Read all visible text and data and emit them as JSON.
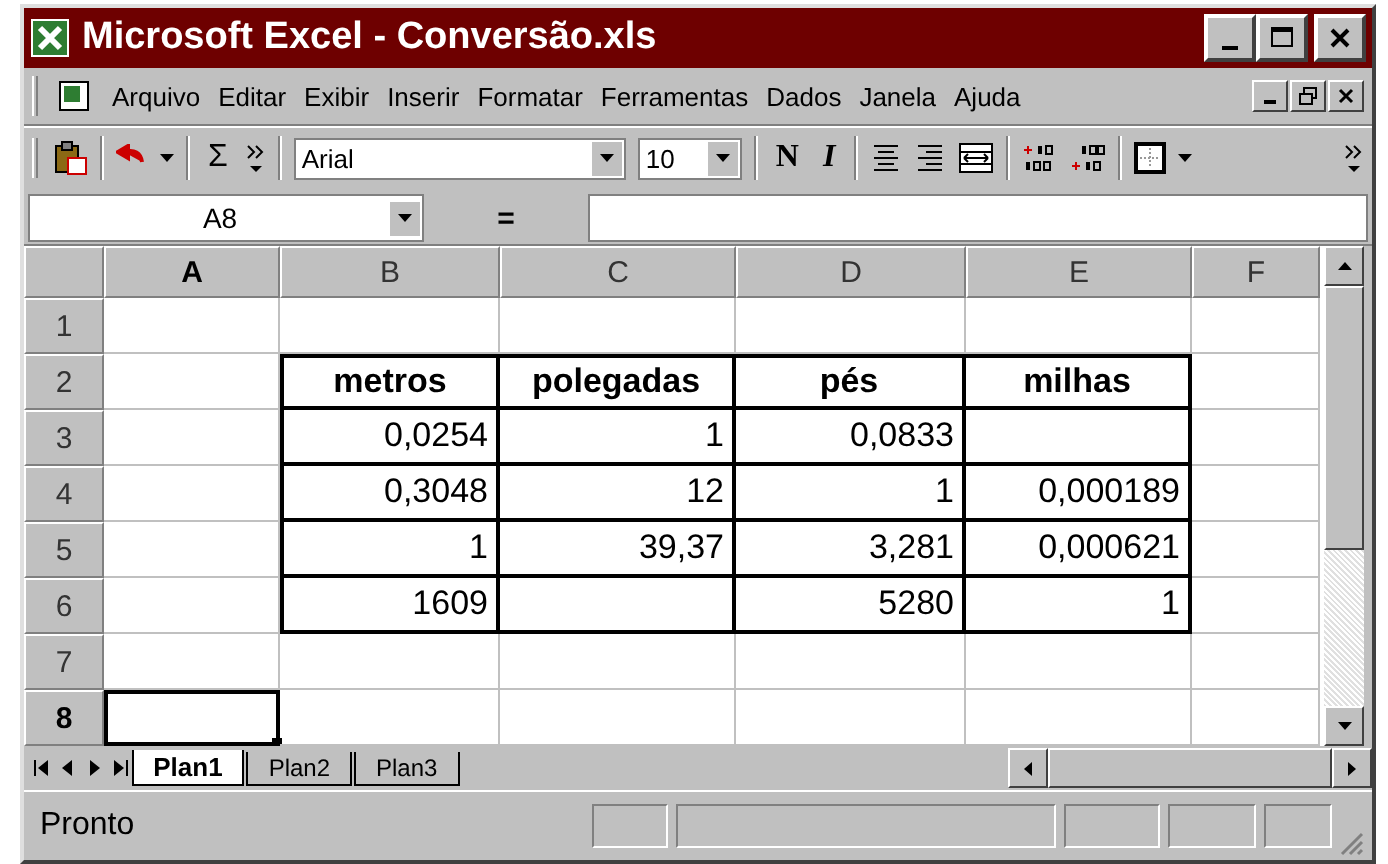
{
  "window": {
    "title": "Microsoft Excel - Conversão.xls"
  },
  "menu": [
    "Arquivo",
    "Editar",
    "Exibir",
    "Inserir",
    "Formatar",
    "Ferramentas",
    "Dados",
    "Janela",
    "Ajuda"
  ],
  "toolbar": {
    "sum": "Σ",
    "font": "Arial",
    "size": "10",
    "bold": "N",
    "italic": "I"
  },
  "formula_bar": {
    "name_box": "A8",
    "equals": "="
  },
  "columns": [
    {
      "label": "A",
      "selected": true,
      "boxed": false
    },
    {
      "label": "B",
      "selected": false,
      "boxed": true
    },
    {
      "label": "C",
      "selected": false,
      "boxed": true
    },
    {
      "label": "D",
      "selected": false,
      "boxed": true
    },
    {
      "label": "E",
      "selected": false,
      "boxed": true
    },
    {
      "label": "F",
      "selected": false,
      "boxed": false
    }
  ],
  "rows": [
    {
      "header": "1",
      "selected": false,
      "boxed": false,
      "kind": "data",
      "cells": [
        null,
        null,
        null,
        null,
        null,
        null
      ]
    },
    {
      "header": "2",
      "selected": false,
      "boxed": true,
      "kind": "heading",
      "cells": [
        null,
        "metros",
        "polegadas",
        "pés",
        "milhas",
        null
      ]
    },
    {
      "header": "3",
      "selected": false,
      "boxed": true,
      "kind": "data",
      "cells": [
        null,
        "0,0254",
        "1",
        "0,0833",
        null,
        null
      ]
    },
    {
      "header": "4",
      "selected": false,
      "boxed": true,
      "kind": "data",
      "cells": [
        null,
        "0,3048",
        "12",
        "1",
        "0,000189",
        null
      ]
    },
    {
      "header": "5",
      "selected": false,
      "boxed": true,
      "kind": "data",
      "cells": [
        null,
        "1",
        "39,37",
        "3,281",
        "0,000621",
        null
      ]
    },
    {
      "header": "6",
      "selected": false,
      "boxed": true,
      "kind": "data",
      "cells": [
        null,
        "1609",
        null,
        "5280",
        "1",
        null
      ]
    },
    {
      "header": "7",
      "selected": false,
      "boxed": false,
      "kind": "data",
      "cells": [
        null,
        null,
        null,
        null,
        null,
        null
      ]
    },
    {
      "header": "8",
      "selected": true,
      "boxed": false,
      "kind": "data",
      "cells": [
        null,
        null,
        null,
        null,
        null,
        null
      ]
    }
  ],
  "sheet_tabs": [
    {
      "label": "Plan1",
      "selected": true
    },
    {
      "label": "Plan2",
      "selected": false
    },
    {
      "label": "Plan3",
      "selected": false
    }
  ],
  "status_bar": {
    "text": "Pronto"
  }
}
